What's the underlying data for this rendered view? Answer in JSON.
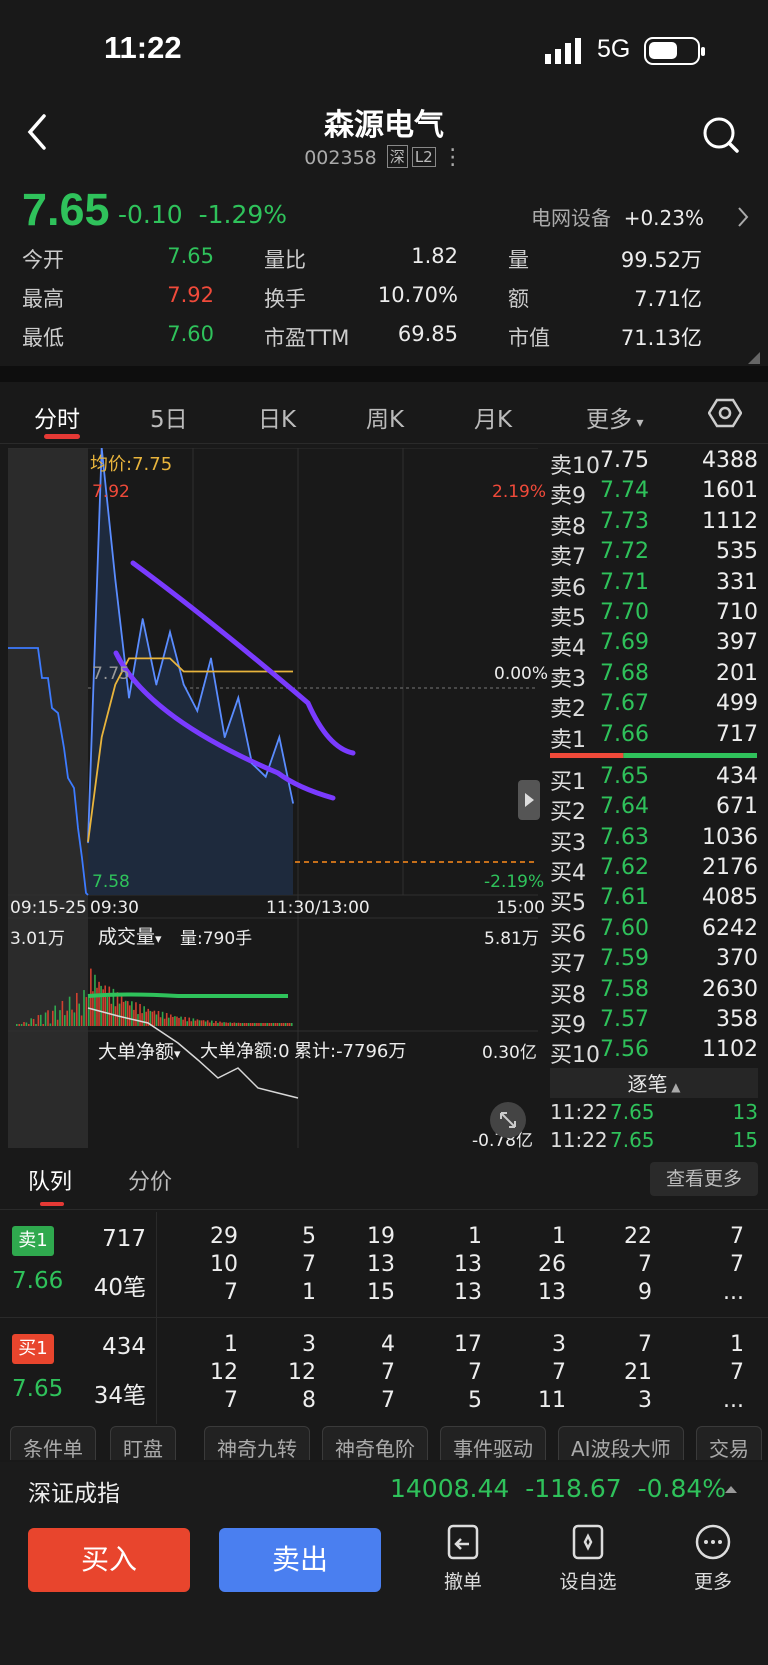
{
  "status": {
    "time": "11:22",
    "network": "5G"
  },
  "header": {
    "title": "森源电气",
    "code": "002358",
    "market": "深",
    "level": "L2"
  },
  "quote": {
    "price": "7.65",
    "change": "-0.10",
    "pct": "-1.29%",
    "industry": "电网设备",
    "industry_pct": "+0.23%"
  },
  "stats": [
    [
      {
        "l": "今开",
        "v": "7.65",
        "c": "g"
      },
      {
        "l": "量比",
        "v": "1.82",
        "c": "w"
      },
      {
        "l": "量",
        "v": "99.52万",
        "c": "w"
      }
    ],
    [
      {
        "l": "最高",
        "v": "7.92",
        "c": "r"
      },
      {
        "l": "换手",
        "v": "10.70%",
        "c": "w"
      },
      {
        "l": "额",
        "v": "7.71亿",
        "c": "w"
      }
    ],
    [
      {
        "l": "最低",
        "v": "7.60",
        "c": "g"
      },
      {
        "l": "市盈TTM",
        "v": "69.85",
        "c": "w"
      },
      {
        "l": "市值",
        "v": "71.13亿",
        "c": "w"
      }
    ]
  ],
  "tabs": [
    "分时",
    "5日",
    "日K",
    "周K",
    "月K",
    "更多"
  ],
  "chart": {
    "avg_label": "均价:7.75",
    "high": "7.92",
    "high_pct": "2.19%",
    "mid": "7.75",
    "mid_pct": "0.00%",
    "low": "7.58",
    "low_pct": "-2.19%",
    "times": [
      "09:15-25",
      "09:30",
      "11:30/13:00",
      "15:00"
    ],
    "vol_left": "3.01万",
    "vol_sel": "成交量",
    "vol_now": "量:790手",
    "vol_right": "5.81万",
    "flow_sel": "大单净额",
    "flow_now": "大单净额:0",
    "flow_cum": "累计:-7796万",
    "flow_top": "0.30亿",
    "flow_bot": "-0.78亿"
  },
  "chart_data": {
    "type": "line",
    "title": "",
    "ylim": [
      7.58,
      7.92
    ],
    "x": [
      "09:30",
      "09:35",
      "09:40",
      "09:45",
      "09:50",
      "09:55",
      "10:00",
      "10:10",
      "10:20",
      "10:30",
      "10:40",
      "10:50",
      "11:00",
      "11:10",
      "11:20",
      "11:22"
    ],
    "series": [
      {
        "name": "",
        "values": [
          7.62,
          7.92,
          7.82,
          7.73,
          7.79,
          7.74,
          7.78,
          7.74,
          7.72,
          7.76,
          7.7,
          7.73,
          7.68,
          7.67,
          7.7,
          7.65
        ]
      },
      {
        "name": "均价",
        "values": [
          7.62,
          7.7,
          7.74,
          7.76,
          7.76,
          7.76,
          7.76,
          7.75,
          7.75,
          7.75,
          7.75,
          7.75,
          7.75,
          7.75,
          7.75,
          7.75
        ]
      }
    ]
  },
  "orderbook": {
    "asks": [
      [
        "卖10",
        "7.75",
        "4388"
      ],
      [
        "卖9",
        "7.74",
        "1601"
      ],
      [
        "卖8",
        "7.73",
        "1112"
      ],
      [
        "卖7",
        "7.72",
        "535"
      ],
      [
        "卖6",
        "7.71",
        "331"
      ],
      [
        "卖5",
        "7.70",
        "710"
      ],
      [
        "卖4",
        "7.69",
        "397"
      ],
      [
        "卖3",
        "7.68",
        "201"
      ],
      [
        "卖2",
        "7.67",
        "499"
      ],
      [
        "卖1",
        "7.66",
        "717"
      ]
    ],
    "bids": [
      [
        "买1",
        "7.65",
        "434"
      ],
      [
        "买2",
        "7.64",
        "671"
      ],
      [
        "买3",
        "7.63",
        "1036"
      ],
      [
        "买4",
        "7.62",
        "2176"
      ],
      [
        "买5",
        "7.61",
        "4085"
      ],
      [
        "买6",
        "7.60",
        "6242"
      ],
      [
        "买7",
        "7.59",
        "370"
      ],
      [
        "买8",
        "7.58",
        "2630"
      ],
      [
        "买9",
        "7.57",
        "358"
      ],
      [
        "买10",
        "7.56",
        "1102"
      ]
    ],
    "ticks_label": "逐笔",
    "ticks": [
      [
        "11:22",
        "7.65",
        "13"
      ],
      [
        "11:22",
        "7.65",
        "15"
      ]
    ]
  },
  "queue": {
    "tabs": [
      "队列",
      "分价"
    ],
    "more": "查看更多",
    "sell": {
      "tag": "卖1",
      "vol": "717",
      "price": "7.66",
      "count": "40笔",
      "grid": [
        [
          "29",
          "5",
          "19",
          "1",
          "1",
          "22",
          "7"
        ],
        [
          "10",
          "7",
          "13",
          "13",
          "26",
          "7",
          "7"
        ],
        [
          "7",
          "1",
          "15",
          "13",
          "13",
          "9",
          "..."
        ]
      ]
    },
    "buy": {
      "tag": "买1",
      "vol": "434",
      "price": "7.65",
      "count": "34笔",
      "grid": [
        [
          "1",
          "3",
          "4",
          "17",
          "3",
          "7",
          "1"
        ],
        [
          "12",
          "12",
          "7",
          "7",
          "7",
          "21",
          "7"
        ],
        [
          "7",
          "8",
          "7",
          "5",
          "11",
          "3",
          "..."
        ]
      ]
    }
  },
  "pills": [
    "条件单",
    "盯盘",
    "神奇九转",
    "神奇龟阶",
    "事件驱动",
    "AI波段大师",
    "交易"
  ],
  "index": {
    "name": "深证成指",
    "value": "14008.44",
    "chg": "-118.67",
    "pct": "-0.84%"
  },
  "actions": {
    "buy": "买入",
    "sell": "卖出",
    "cancel": "撤单",
    "watch": "设自选",
    "more": "更多"
  }
}
